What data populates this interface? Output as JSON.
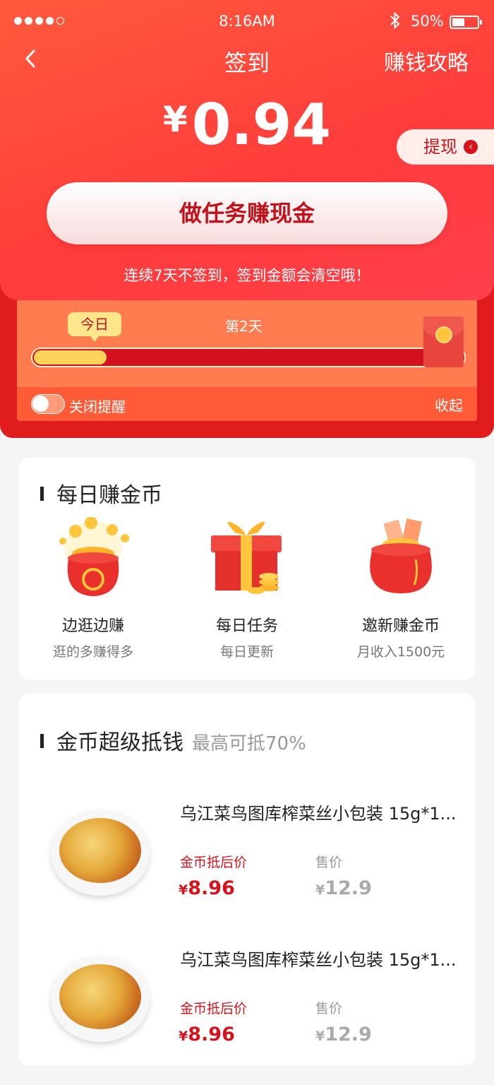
{
  "status": {
    "time": "8:16AM",
    "battery": "50%"
  },
  "nav": {
    "title": "签到",
    "right": "赚钱攻略"
  },
  "balance": {
    "currency": "¥",
    "amount": "0.94"
  },
  "withdraw": {
    "label": "提现"
  },
  "task_button": {
    "label": "做任务赚现金"
  },
  "warning": "连续7天不签到，签到金额会清空哦！",
  "progress": {
    "today_label": "今日",
    "day_label": "第2天",
    "fill_fraction": 0.17
  },
  "reminder": {
    "toggle_label": "关闭提醒",
    "collapse_label": "收起"
  },
  "daily": {
    "title": "每日赚金币",
    "items": [
      {
        "name": "边逛边赚",
        "desc": "逛的多赚得多",
        "icon": "coin-pouch-icon"
      },
      {
        "name": "每日任务",
        "desc": "每日更新",
        "icon": "gift-box-icon"
      },
      {
        "name": "邀新赚金币",
        "desc": "月收入1500元",
        "icon": "money-bag-icon"
      }
    ]
  },
  "deduct": {
    "title": "金币超级抵钱",
    "subtitle": "最高可抵70%",
    "products": [
      {
        "name": "乌江菜鸟图库榨菜丝小包装 15g*1...",
        "coin_label": "金币抵后价",
        "coin_price_cur": "¥",
        "coin_price": "8.96",
        "sale_label": "售价",
        "sale_price_cur": "¥",
        "sale_price": "12.9"
      },
      {
        "name": "乌江菜鸟图库榨菜丝小包装 15g*1...",
        "coin_label": "金币抵后价",
        "coin_price_cur": "¥",
        "coin_price": "8.96",
        "sale_label": "售价",
        "sale_price_cur": "¥",
        "sale_price": "12.9"
      }
    ]
  },
  "colors": {
    "primary": "#ff3b3b",
    "accent": "#d8121c",
    "gold": "#ffd35a"
  }
}
